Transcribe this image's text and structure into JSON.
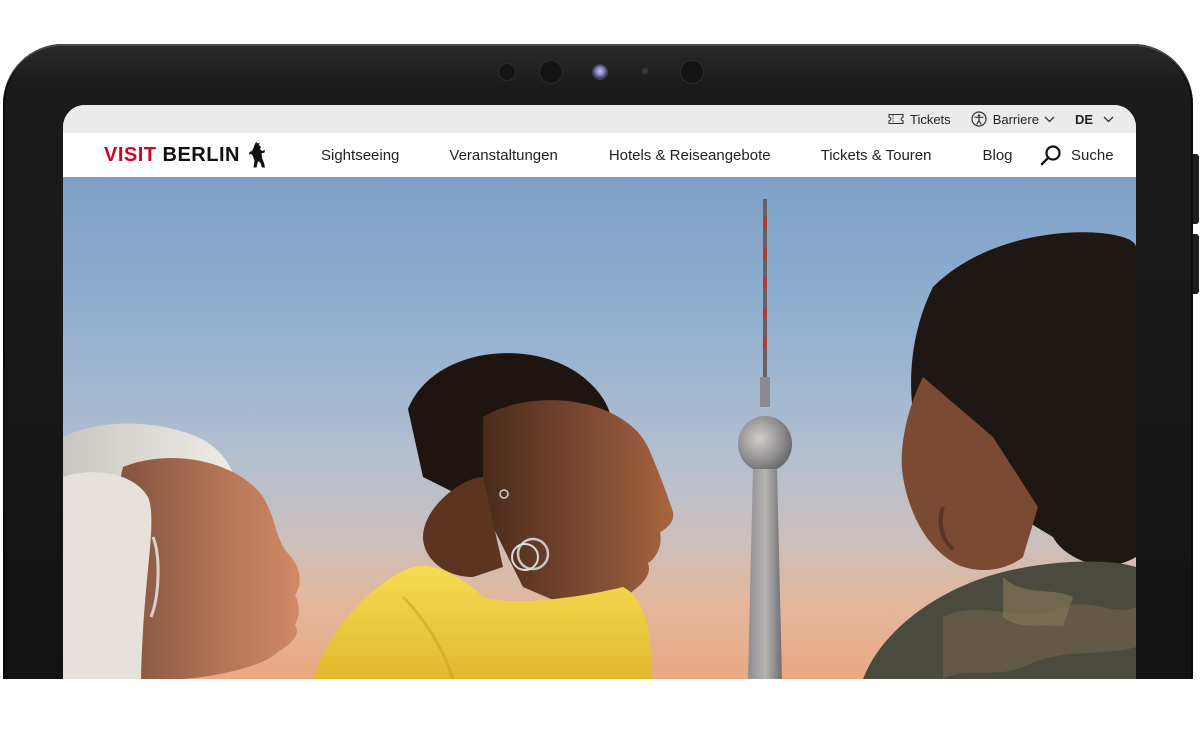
{
  "utility_bar": {
    "tickets_label": "Tickets",
    "accessibility_label": "Barriere",
    "language_label": "DE"
  },
  "header": {
    "logo_visit": "VISIT",
    "logo_berlin": "BERLIN"
  },
  "nav": {
    "items": [
      {
        "label": "Sightseeing"
      },
      {
        "label": "Veranstaltungen"
      },
      {
        "label": "Hotels & Reiseangebote"
      },
      {
        "label": "Tickets & Touren"
      },
      {
        "label": "Blog"
      }
    ],
    "search_label": "Suche"
  },
  "hero": {
    "image_subject": "three-people-with-tv-tower"
  },
  "colors": {
    "brand_red": "#d7001f",
    "utility_bar_bg": "#ebebeb",
    "text": "#222222",
    "hoodie_yellow": "#f3d43a"
  },
  "icons": {
    "tickets": "ticket-icon",
    "accessibility": "accessibility-icon",
    "chevron": "chevron-down-icon",
    "search": "search-icon",
    "logo": "berlin-bear-icon"
  }
}
